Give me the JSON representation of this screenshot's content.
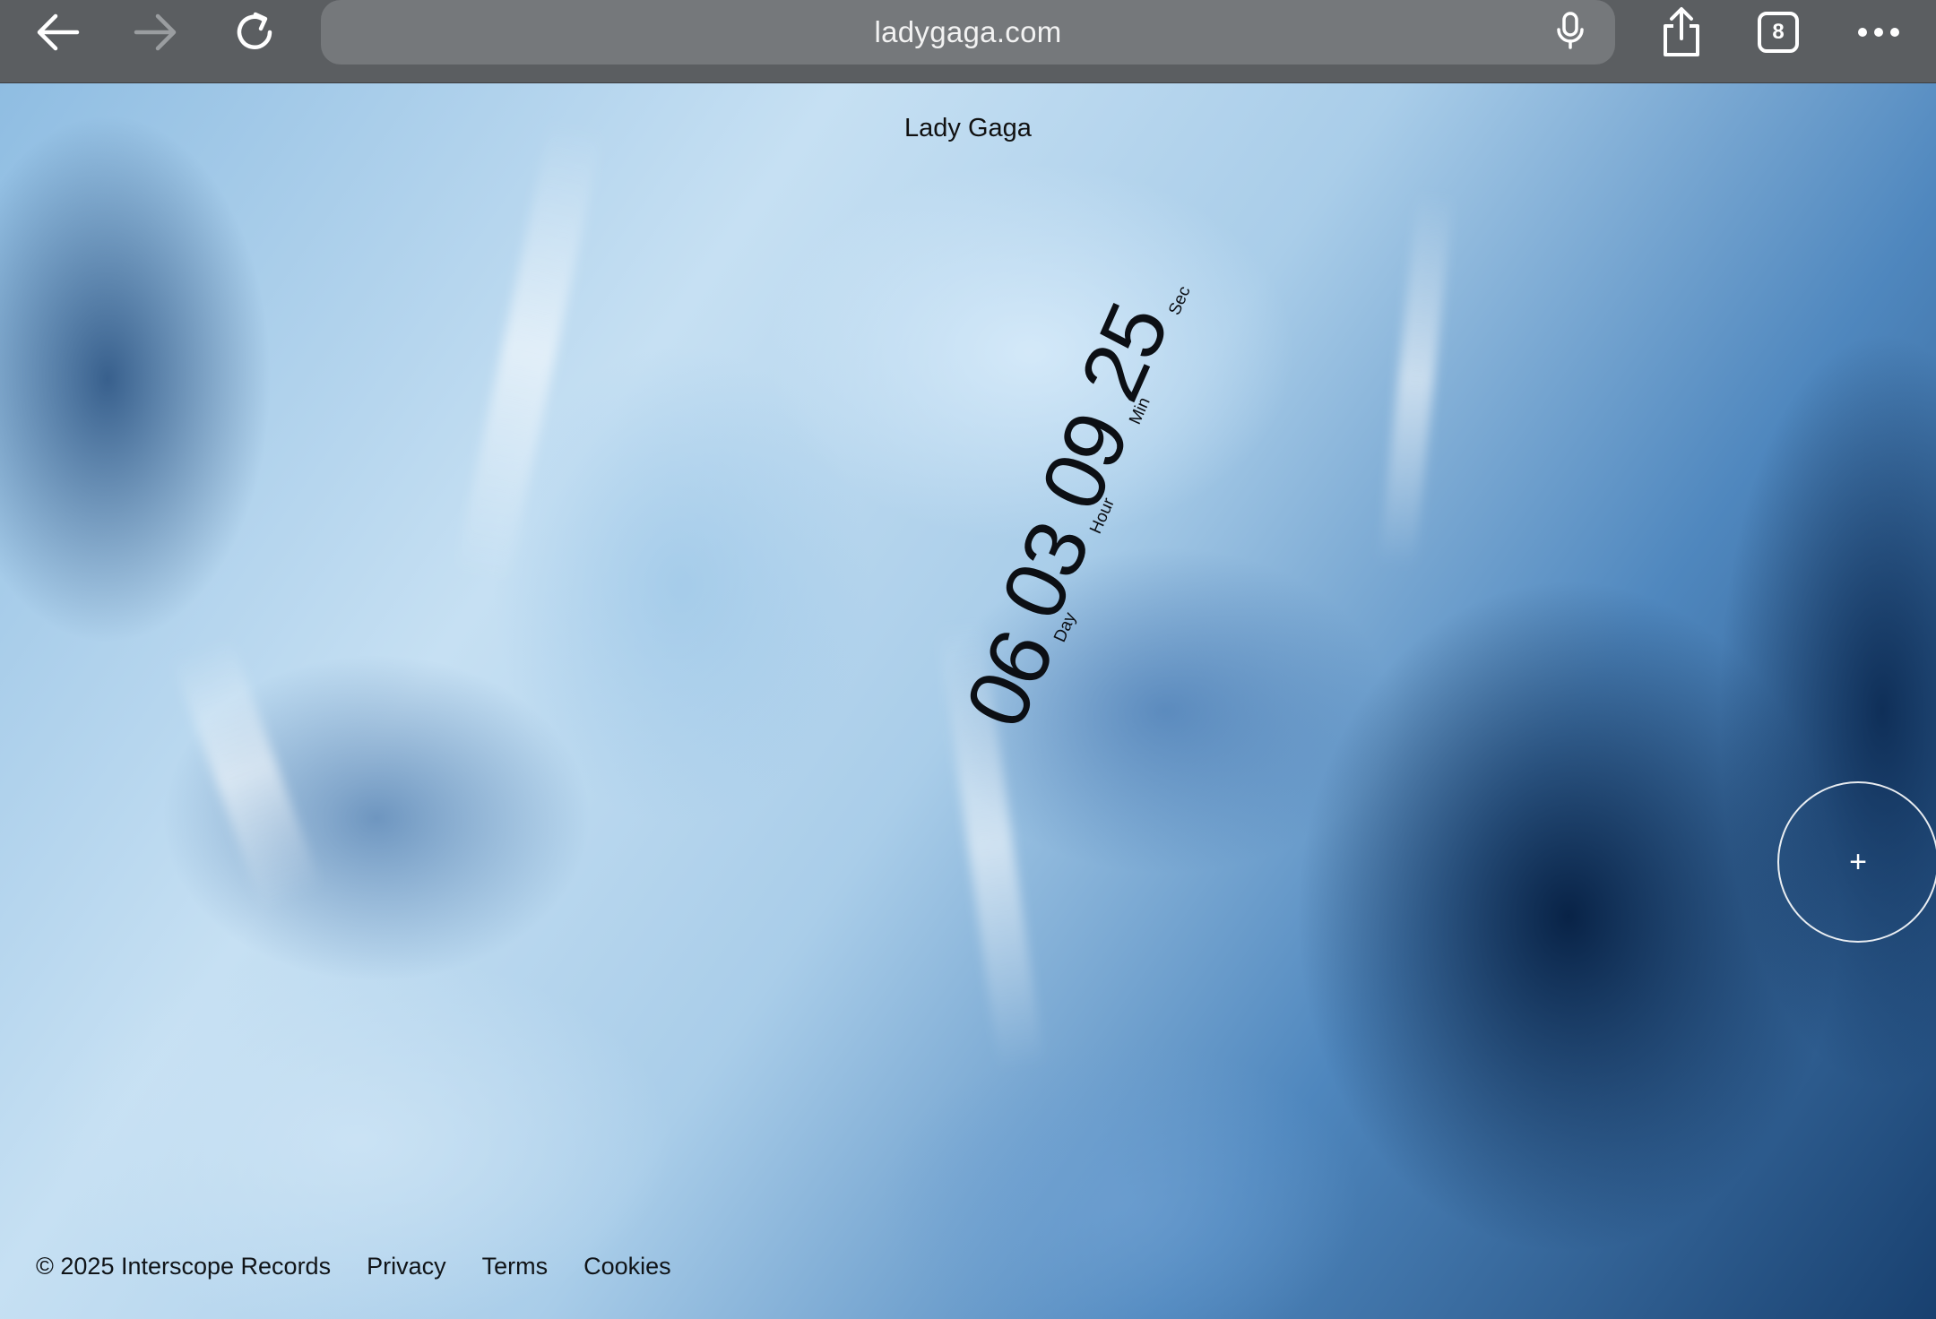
{
  "browser": {
    "url": "ladygaga.com",
    "tab_count": "8",
    "icons": {
      "back": "arrow-left-icon",
      "forward": "arrow-right-icon",
      "reload": "reload-icon",
      "mic": "microphone-icon",
      "share": "share-icon",
      "more": "ellipsis-icon"
    }
  },
  "page": {
    "title": "Lady Gaga",
    "countdown": {
      "days": "06",
      "days_label": "Day",
      "hours": "03",
      "hours_label": "Hour",
      "minutes": "09",
      "minutes_label": "Min",
      "seconds": "25",
      "seconds_label": "Sec"
    },
    "cursor_icon": "plus-icon",
    "footer": {
      "copyright": "© 2025 Interscope Records",
      "links": [
        "Privacy",
        "Terms",
        "Cookies"
      ]
    }
  },
  "colors": {
    "toolbar": "#5b5e61",
    "url_bar": "#75787b",
    "text_dark": "#0c0f14"
  }
}
